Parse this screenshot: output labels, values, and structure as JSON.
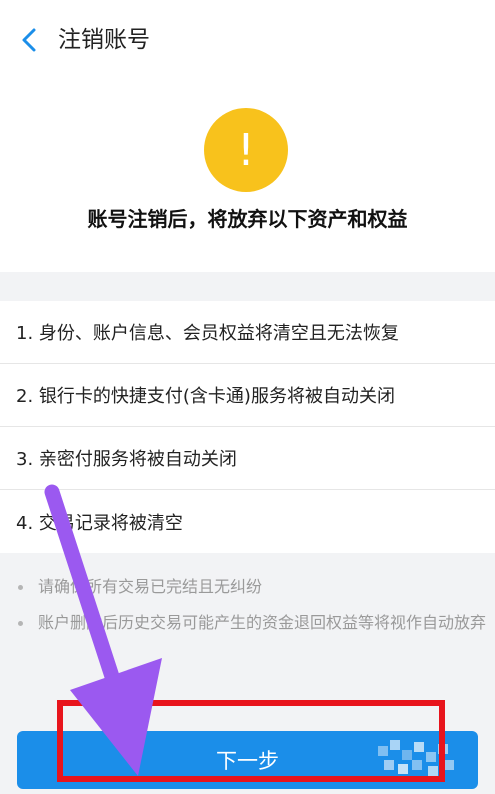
{
  "header": {
    "back_icon": "chevron-left-icon",
    "title": "注销账号"
  },
  "warning": {
    "icon": "exclamation-icon",
    "symbol": "!",
    "title": "账号注销后，将放弃以下资产和权益"
  },
  "rights": [
    "1. 身份、账户信息、会员权益将清空且无法恢复",
    "2. 银行卡的快捷支付(含卡通)服务将被自动关闭",
    "3. 亲密付服务将被自动关闭",
    "4. 交易记录将被清空"
  ],
  "notes": [
    "请确保所有交易已完结且无纠纷",
    "账户删除后历史交易可能产生的资金退回权益等将视作自动放弃"
  ],
  "footer": {
    "next_label": "下一步"
  },
  "colors": {
    "accent": "#1b8ee9",
    "warning": "#f8c21c",
    "annotation_arrow": "#9b59f0",
    "annotation_box": "#e8141c"
  }
}
